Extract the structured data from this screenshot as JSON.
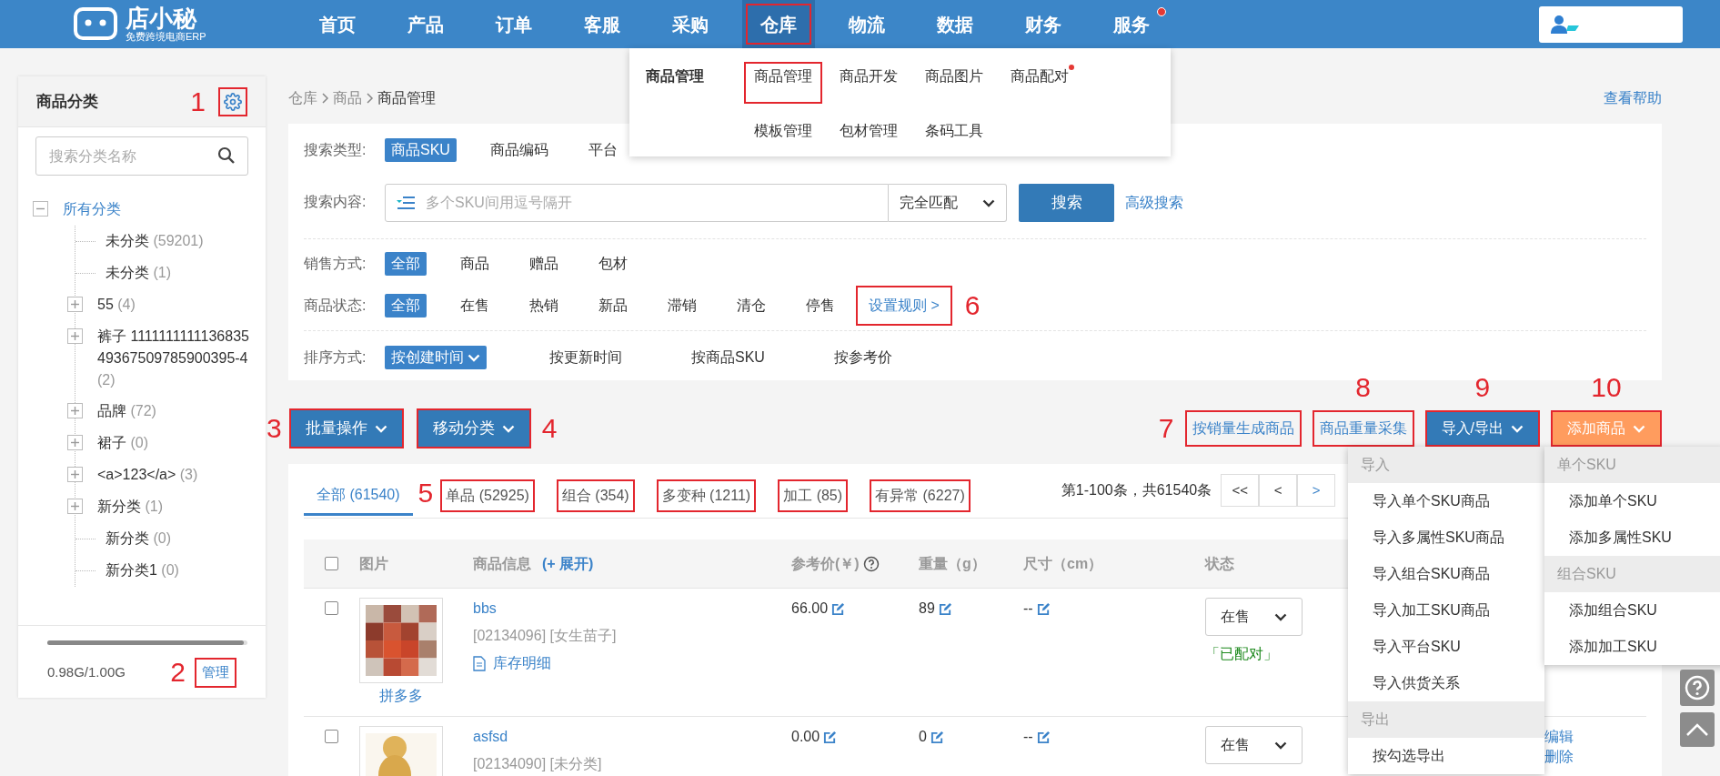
{
  "header": {
    "logo_text": "店小秘",
    "logo_subtitle": "免费跨境电商ERP",
    "nav": [
      {
        "label": "首页",
        "selected": false,
        "marked": false,
        "badge": false
      },
      {
        "label": "产品",
        "selected": false,
        "marked": false,
        "badge": false
      },
      {
        "label": "订单",
        "selected": false,
        "marked": false,
        "badge": false
      },
      {
        "label": "客服",
        "selected": false,
        "marked": false,
        "badge": false
      },
      {
        "label": "采购",
        "selected": false,
        "marked": false,
        "badge": false
      },
      {
        "label": "仓库",
        "selected": true,
        "marked": true,
        "badge": false
      },
      {
        "label": "物流",
        "selected": false,
        "marked": false,
        "badge": false
      },
      {
        "label": "数据",
        "selected": false,
        "marked": false,
        "badge": false
      },
      {
        "label": "财务",
        "selected": false,
        "marked": false,
        "badge": false
      },
      {
        "label": "服务",
        "selected": false,
        "marked": false,
        "badge": true
      }
    ]
  },
  "nav_menu": {
    "group": "商品管理",
    "items": [
      {
        "label": "商品管理",
        "marked": true,
        "badge": false
      },
      {
        "label": "商品开发",
        "marked": false,
        "badge": false
      },
      {
        "label": "商品图片",
        "marked": false,
        "badge": false
      },
      {
        "label": "商品配对",
        "marked": false,
        "badge": true
      },
      {
        "label": "模板管理",
        "marked": false,
        "badge": false
      },
      {
        "label": "包材管理",
        "marked": false,
        "badge": false
      },
      {
        "label": "条码工具",
        "marked": false,
        "badge": false
      }
    ]
  },
  "sidebar": {
    "title": "商品分类",
    "settings_note": "1",
    "search_placeholder": "搜索分类名称",
    "tree": [
      {
        "label": "所有分类",
        "kind": "folder",
        "expanded": true,
        "selected": true,
        "children": [
          {
            "label": "未分类",
            "count": "(59201)",
            "kind": "leaf",
            "selected": false
          },
          {
            "label": "未分类",
            "count": "(1)",
            "kind": "leaf",
            "selected": false
          },
          {
            "label": "55",
            "count": "(4)",
            "kind": "folder",
            "expanded": false,
            "selected": false
          },
          {
            "label": "裤子 111111111113683549367509785900395-4",
            "count": "(2)",
            "kind": "folder",
            "expanded": false,
            "selected": false
          },
          {
            "label": "品牌",
            "count": "(72)",
            "kind": "folder",
            "expanded": false,
            "selected": false
          },
          {
            "label": "裙子",
            "count": "(0)",
            "kind": "folder",
            "expanded": false,
            "selected": false
          },
          {
            "label": "<a>123</a>",
            "count": "(3)",
            "kind": "folder",
            "expanded": false,
            "selected": false
          },
          {
            "label": "新分类",
            "count": "(1)",
            "kind": "folder",
            "expanded": false,
            "selected": false
          },
          {
            "label": "新分类",
            "count": "(0)",
            "kind": "leaf",
            "selected": false
          },
          {
            "label": "新分类1",
            "count": "(0)",
            "kind": "leaf",
            "selected": false
          }
        ]
      }
    ],
    "storage": {
      "level": 0.98,
      "reading": "0.98G/1.00G"
    },
    "manage_label": "管理",
    "manage_note": "2"
  },
  "breadcrumb": [
    "仓库",
    "商品",
    "商品管理"
  ],
  "help_link": "查看帮助",
  "filters": {
    "search_type": {
      "label": "搜索类型:",
      "options": [
        {
          "label": "商品SKU",
          "selected": true
        },
        {
          "label": "商品编码",
          "selected": false
        },
        {
          "label": "平台",
          "selected": false
        }
      ]
    },
    "search": {
      "label": "搜索内容:",
      "placeholder": "多个SKU间用逗号隔开",
      "match": "完全匹配",
      "button": "搜索",
      "advanced": "高级搜索"
    },
    "sale_mode": {
      "label": "销售方式:",
      "options": [
        {
          "label": "全部",
          "selected": true
        },
        {
          "label": "商品",
          "selected": false
        },
        {
          "label": "赠品",
          "selected": false
        },
        {
          "label": "包材",
          "selected": false
        }
      ]
    },
    "status": {
      "label": "商品状态:",
      "options": [
        {
          "label": "全部",
          "selected": true
        },
        {
          "label": "在售",
          "selected": false
        },
        {
          "label": "热销",
          "selected": false
        },
        {
          "label": "新品",
          "selected": false
        },
        {
          "label": "滞销",
          "selected": false
        },
        {
          "label": "清仓",
          "selected": false
        },
        {
          "label": "停售",
          "selected": false
        }
      ],
      "rule_link": "设置规则 >",
      "rule_note": "6"
    },
    "sort": {
      "label": "排序方式:",
      "options": [
        {
          "label": "按创建时间",
          "selected": true
        },
        {
          "label": "按更新时间",
          "selected": false
        },
        {
          "label": "按商品SKU",
          "selected": false
        },
        {
          "label": "按参考价",
          "selected": false
        }
      ]
    }
  },
  "actions_left": [
    {
      "label": "批量操作",
      "note": "3"
    },
    {
      "label": "移动分类",
      "note": "4"
    }
  ],
  "actions_right": [
    {
      "kind": "link",
      "label": "按销量生成商品",
      "note": "7"
    },
    {
      "kind": "link",
      "label": "商品重量采集",
      "note": "8"
    },
    {
      "kind": "primary",
      "label": "导入/导出",
      "note": "9"
    },
    {
      "kind": "accent",
      "label": "添加商品",
      "note": "10"
    }
  ],
  "tabs": [
    {
      "label": "全部 (61540)",
      "selected": true,
      "marked": false
    },
    {
      "label": "单品 (52925)",
      "selected": false,
      "marked": true,
      "note": "5"
    },
    {
      "label": "组合 (354)",
      "selected": false,
      "marked": true
    },
    {
      "label": "多变种 (1211)",
      "selected": false,
      "marked": true
    },
    {
      "label": "加工 (85)",
      "selected": false,
      "marked": true
    },
    {
      "label": "有异常 (6227)",
      "selected": false,
      "marked": true
    }
  ],
  "pagination": {
    "summary": "第1-100条，共61540条",
    "buttons": [
      "<<",
      "<",
      ">"
    ]
  },
  "table": {
    "columns": [
      {
        "label": "图片"
      },
      {
        "label": "商品信息",
        "extra": "(+ 展开)"
      },
      {
        "label": "参考价(￥)",
        "help": true
      },
      {
        "label": "重量（g）"
      },
      {
        "label": "尺寸（cm）"
      },
      {
        "label": "状态"
      }
    ],
    "header_checked": false,
    "rows": [
      {
        "checked": false,
        "platform": "拼多多",
        "name": "bbs",
        "meta": "[02134096] [女生苗子]",
        "detail_link": "库存明细",
        "price": "66.00",
        "weight": "89",
        "size": "--",
        "status": "在售",
        "pair": "「已配对」"
      },
      {
        "checked": false,
        "name": "asfsd",
        "meta": "[02134090] [未分类]",
        "price": "0.00",
        "weight": "0",
        "size": "--",
        "status": "在售",
        "ops": [
          "编辑",
          "删除"
        ]
      }
    ]
  },
  "import_menu": [
    {
      "kind": "header",
      "label": "导入"
    },
    {
      "kind": "item",
      "label": "导入单个SKU商品"
    },
    {
      "kind": "item",
      "label": "导入多属性SKU商品"
    },
    {
      "kind": "item",
      "label": "导入组合SKU商品"
    },
    {
      "kind": "item",
      "label": "导入加工SKU商品"
    },
    {
      "kind": "item",
      "label": "导入平台SKU"
    },
    {
      "kind": "item",
      "label": "导入供货关系"
    },
    {
      "kind": "header",
      "label": "导出"
    },
    {
      "kind": "item",
      "label": "按勾选导出"
    }
  ],
  "add_menu": [
    {
      "kind": "header",
      "label": "单个SKU"
    },
    {
      "kind": "item",
      "label": "添加单个SKU"
    },
    {
      "kind": "item",
      "label": "添加多属性SKU"
    },
    {
      "kind": "header",
      "label": "组合SKU"
    },
    {
      "kind": "item",
      "label": "添加组合SKU"
    },
    {
      "kind": "item",
      "label": "添加加工SKU"
    }
  ]
}
